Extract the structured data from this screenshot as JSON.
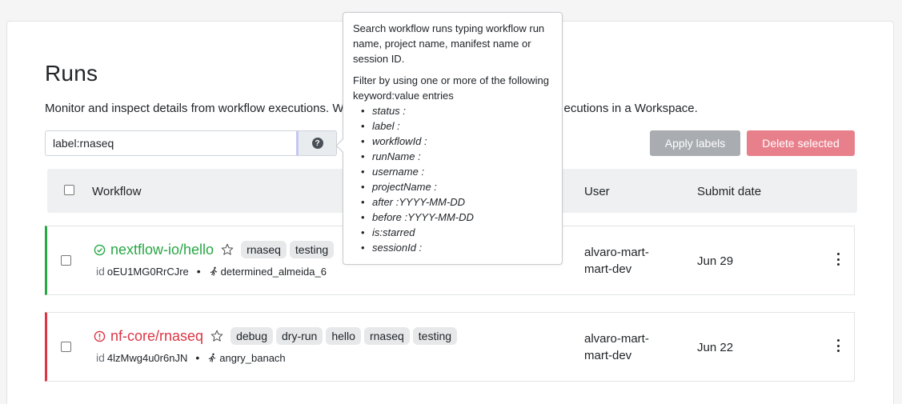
{
  "page": {
    "title": "Runs",
    "description": "Monitor and inspect details from workflow executions. W",
    "description_tail": "ecutions in a Workspace."
  },
  "search": {
    "value": "label:rnaseq",
    "help_icon": "question-circle-icon"
  },
  "actions": {
    "apply_labels": "Apply labels",
    "delete_selected": "Delete selected"
  },
  "table": {
    "headers": {
      "workflow": "Workflow",
      "user": "User",
      "submit_date": "Submit date"
    }
  },
  "runs": [
    {
      "status": "succeeded",
      "status_icon": "check-circle-icon",
      "name": "nextflow-io/hello",
      "tags": [
        "rnaseq",
        "testing"
      ],
      "id_label": "id",
      "id": "oEU1MG0RrCJre",
      "run_name": "determined_almeida_6",
      "user_line1": "alvaro-mart-",
      "user_line2": "mart-dev",
      "date": "Jun 29"
    },
    {
      "status": "failed",
      "status_icon": "exclamation-circle-icon",
      "name": "nf-core/rnaseq",
      "tags": [
        "debug",
        "dry-run",
        "hello",
        "rnaseq",
        "testing"
      ],
      "id_label": "id",
      "id": "4lzMwg4u0r6nJN",
      "run_name": "angry_banach",
      "user_line1": "alvaro-mart-",
      "user_line2": "mart-dev",
      "date": "Jun 22"
    }
  ],
  "tooltip": {
    "intro": "Search workflow runs typing workflow run name, project name, manifest name or session ID.",
    "filter_intro": "Filter by using one or more of the following keyword:value entries",
    "keywords": [
      "status :",
      "label :",
      "workflowId :",
      "runName :",
      "username :",
      "projectName :",
      "after :YYYY-MM-DD",
      "before :YYYY-MM-DD",
      "is:starred",
      "sessionId :"
    ]
  },
  "colors": {
    "success": "#28a745",
    "danger": "#dc3545",
    "apply_btn": "#a9acb0",
    "delete_btn": "#e8808c"
  }
}
